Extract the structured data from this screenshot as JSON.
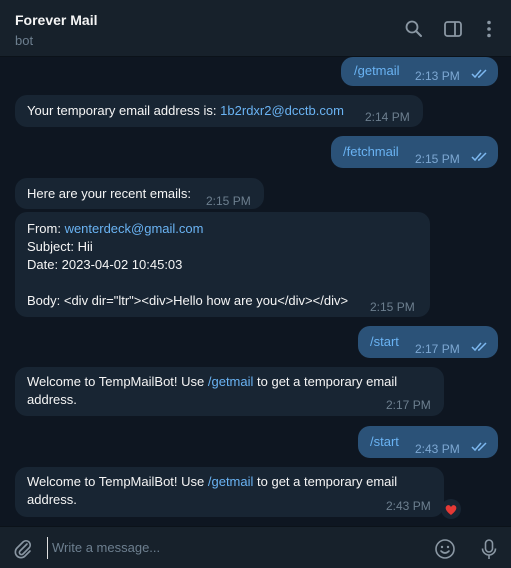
{
  "header": {
    "title": "Forever Mail",
    "subtitle": "bot"
  },
  "messages": [
    {
      "text": "/getmail",
      "time": "2:13 PM"
    },
    {
      "prefix": "Your temporary email address is: ",
      "email": "1b2rdxr2@dcctb.com",
      "time": "2:14 PM"
    },
    {
      "text": "/fetchmail",
      "time": "2:15 PM"
    },
    {
      "text": "Here are your recent emails:",
      "time": "2:15 PM"
    },
    {
      "from_label": "From: ",
      "from_email": "wenterdeck@gmail.com",
      "subject": "Subject: Hii",
      "date": "Date: 2023-04-02 10:45:03",
      "body": "Body: <div dir=\"ltr\"><div>Hello how are you</div></div>",
      "time": "2:15 PM"
    },
    {
      "text": "/start",
      "time": "2:17 PM"
    },
    {
      "line1_prefix": "Welcome to TempMailBot! Use ",
      "cmd": "/getmail",
      "line1_suffix": " to get a temporary email",
      "line2": "address.",
      "time": "2:17 PM"
    },
    {
      "text": "/start",
      "time": "2:43 PM"
    },
    {
      "line1_prefix": "Welcome to TempMailBot! Use ",
      "cmd": "/getmail",
      "line1_suffix": " to get a temporary email",
      "line2": "address.",
      "time": "2:43 PM",
      "reaction": "heart"
    }
  ],
  "composer": {
    "placeholder": "Write a message..."
  },
  "icons": [
    "search-icon",
    "sidebar-toggle-icon",
    "more-vertical-icon",
    "attach-icon",
    "emoji-icon",
    "microphone-icon",
    "read-checkmarks-icon",
    "heart-reaction-icon"
  ],
  "colors": {
    "background": "#0e1621",
    "incoming": "#182533",
    "outgoing": "#2b5278",
    "link": "#6ab3f3",
    "heart": "#e53935"
  }
}
